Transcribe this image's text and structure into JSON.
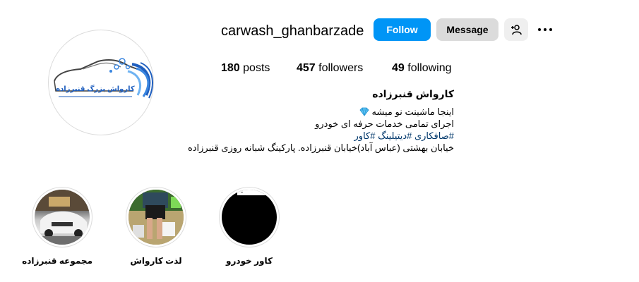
{
  "profile": {
    "username": "carwash_ghanbarzade",
    "logo_text": "کارواش بزرگ قنبرزاده",
    "buttons": {
      "follow": "Follow",
      "message": "Message"
    },
    "icons": {
      "add_user": "add-user-icon",
      "more": "more-options-icon",
      "verified_emoji": "gem-icon"
    }
  },
  "stats": {
    "posts_count": "180",
    "posts_label": "posts",
    "followers_count": "457",
    "followers_label": "followers",
    "following_count": "49",
    "following_label": "following"
  },
  "bio": {
    "name": "کارواش قنبرزاده",
    "line1": "اینجا ماشینت نو میشه",
    "line2": "اجرای تمامی خدمات حرفه ای خودرو",
    "line3": "#صافکاری #دیتیلینگ #کاور",
    "line4": "خیابان بهشتی (عباس آباد)خیابان قنبرزاده. پارکینگ شبانه روزی قنبرزاده"
  },
  "highlights": [
    {
      "label": "مجموعه قنبرزاده"
    },
    {
      "label": "لذت کارواش"
    },
    {
      "label": "کاور خودرو"
    }
  ],
  "colors": {
    "primary_blue": "#0095f6",
    "secondary_btn": "#dbdbdb",
    "hashtag": "#00376b",
    "logo_blue": "#1f5fbf"
  }
}
